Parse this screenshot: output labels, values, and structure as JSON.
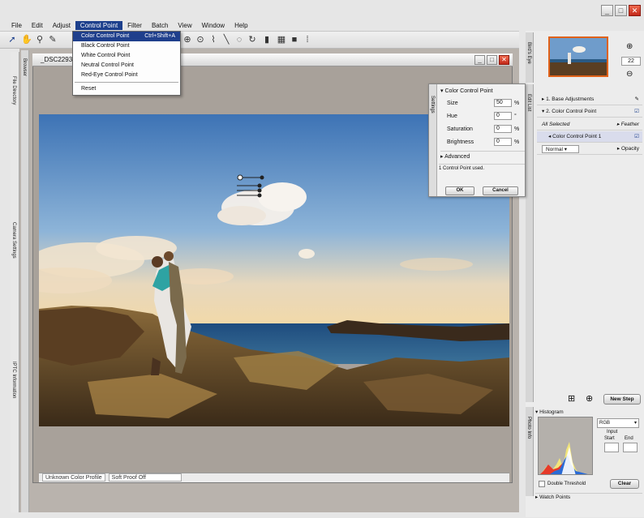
{
  "window": {
    "min_label": "_",
    "max_label": "□",
    "close_label": "✕"
  },
  "menus": [
    "File",
    "Edit",
    "Adjust",
    "Control Point",
    "Filter",
    "Batch",
    "View",
    "Window",
    "Help"
  ],
  "active_menu": "Control Point",
  "dropdown": {
    "items": [
      {
        "label": "Color Control Point",
        "shortcut": "Ctrl+Shift+A",
        "selected": true
      },
      {
        "label": "Black Control Point",
        "shortcut": ""
      },
      {
        "label": "White Control Point",
        "shortcut": ""
      },
      {
        "label": "Neutral Control Point",
        "shortcut": ""
      },
      {
        "label": "Red-Eye Control Point",
        "shortcut": ""
      }
    ],
    "reset": "Reset"
  },
  "document": {
    "title": "_DSC2293."
  },
  "left_tabs": {
    "browser": "Browser",
    "file_directory": "File Directory",
    "camera_settings": "Camera Settings",
    "iptc": "IPTC Information"
  },
  "settings": {
    "tab": "Settings",
    "title": "Color Control Point",
    "rows": [
      {
        "label": "Size",
        "value": "50",
        "unit": "%"
      },
      {
        "label": "Hue",
        "value": "0",
        "unit": "°"
      },
      {
        "label": "Saturation",
        "value": "0",
        "unit": "%"
      },
      {
        "label": "Brightness",
        "value": "0",
        "unit": "%"
      }
    ],
    "advanced": "Advanced",
    "info": "1 Control Point used.",
    "ok": "OK",
    "cancel": "Cancel"
  },
  "status": {
    "profile": "Unknown Color Profile",
    "proof": "Soft Proof Off"
  },
  "birds_eye": {
    "tab": "Bird's Eye",
    "zoom": "22"
  },
  "edit_list": {
    "tab": "Edit List",
    "base": "1. Base Adjustments",
    "ccp": "2. Color Control Point",
    "all_selected": "All Selected",
    "feather": "Feather",
    "ccp1": "Color Control Point 1",
    "blend_mode": "Normal",
    "opacity": "Opacity",
    "new_step": "New Step"
  },
  "photo_info": {
    "tab": "Photo Info",
    "histogram": "Histogram",
    "channel": "RGB",
    "input": "Input",
    "start": "Start",
    "end": "End",
    "double_threshold": "Double Threshold",
    "clear": "Clear",
    "watch_points": "Watch Points"
  },
  "colors": {
    "accent": "#1c3f8c",
    "close": "#c2281a",
    "thumb_border": "#e0621a"
  }
}
